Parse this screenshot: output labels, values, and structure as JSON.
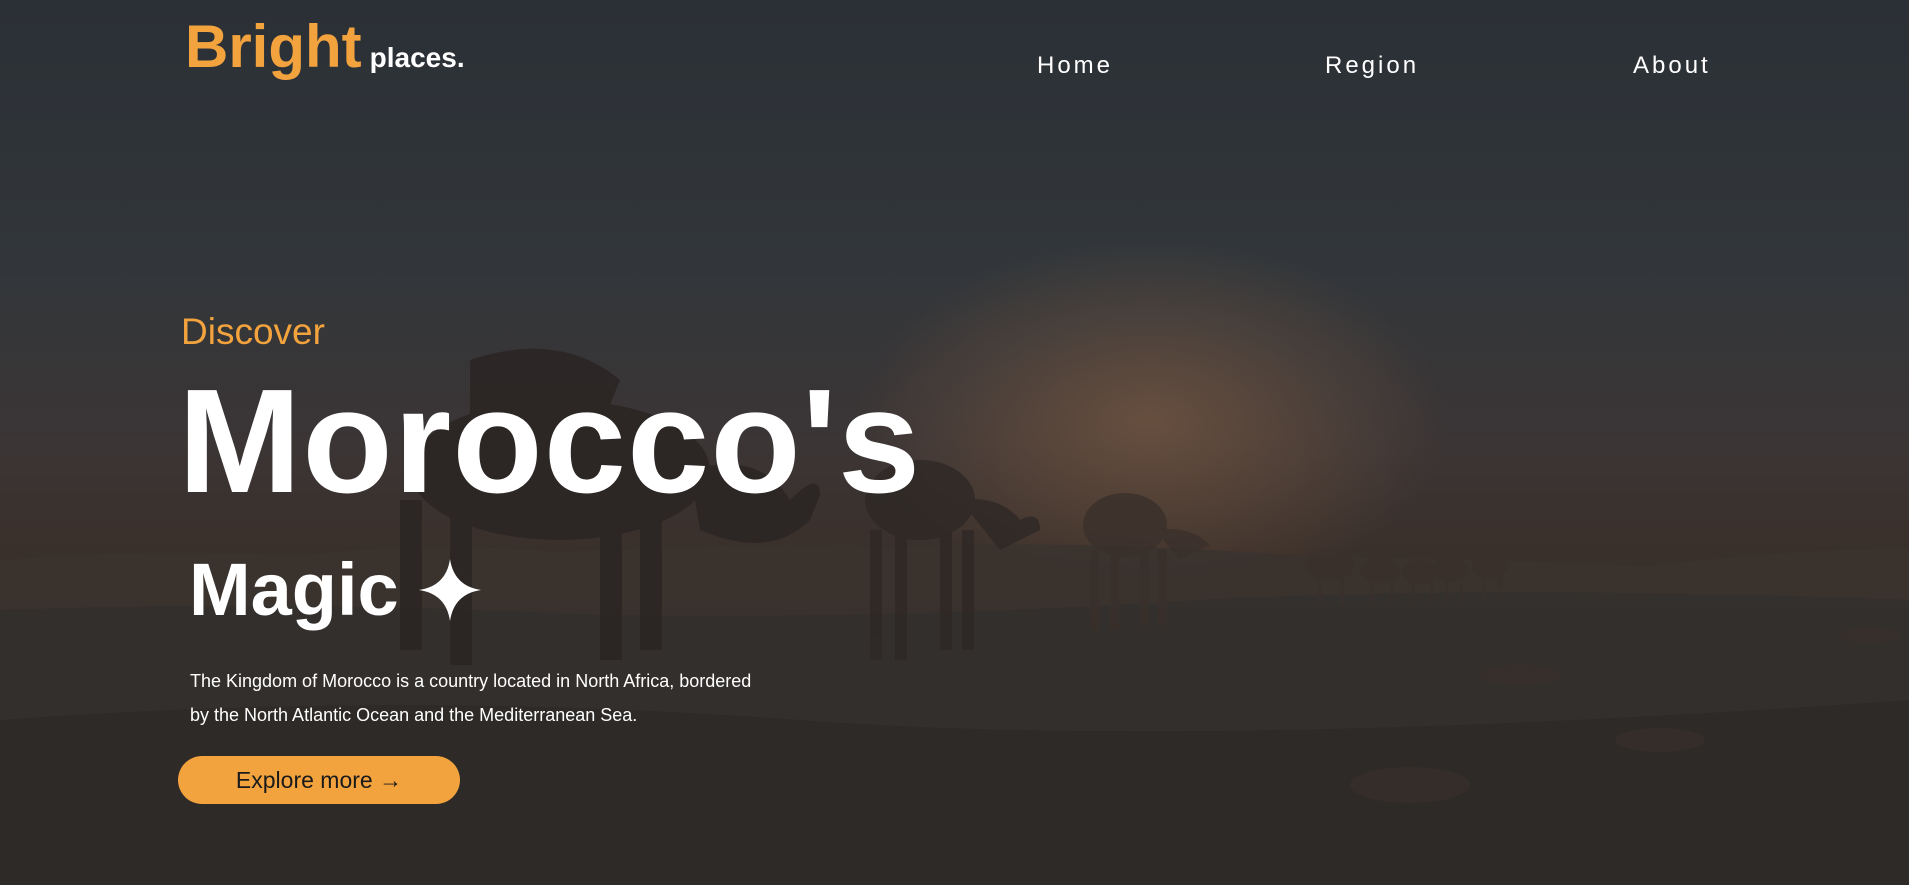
{
  "brand": {
    "name_primary": "Bright",
    "name_secondary": "places",
    "name_dot": "."
  },
  "nav": {
    "items": [
      {
        "label": "Home"
      },
      {
        "label": "Region"
      },
      {
        "label": "About"
      }
    ]
  },
  "hero": {
    "eyebrow": "Discover",
    "title_line1": "Morocco's",
    "title_line2": "Magic",
    "sparkle_icon": "four-point-star-icon",
    "description_line1": "The Kingdom of Morocco is a country located in North Africa, bordered",
    "description_line2": "by the North Atlantic Ocean and the Mediterranean Sea.",
    "cta_label": "Explore more →"
  },
  "colors": {
    "accent": "#f2a33e",
    "text": "#ffffff",
    "background_dark": "#2b3036"
  },
  "background_image": "desert-camel-caravan-at-sunset"
}
